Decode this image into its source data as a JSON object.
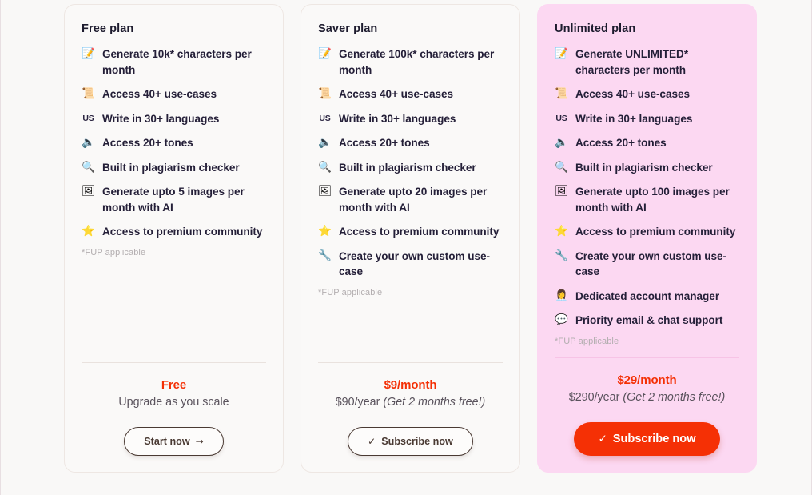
{
  "page": {
    "background_color": "#f9f8f7",
    "accent_color": "#f43005",
    "featured_card_color": "#fcd8f2"
  },
  "plans": [
    {
      "id": "free",
      "title": "Free plan",
      "featured": false,
      "features": [
        {
          "icon": "memo-icon",
          "glyph": "📝",
          "text": "Generate 10k* characters per month"
        },
        {
          "icon": "scroll-icon",
          "glyph": "📜",
          "text": "Access 40+ use-cases"
        },
        {
          "icon": "us-flag-icon",
          "glyph": "US",
          "text": "Write in 30+ languages"
        },
        {
          "icon": "speaker-icon",
          "glyph": "🔈",
          "text": "Access 20+ tones"
        },
        {
          "icon": "magnifier-icon",
          "glyph": "🔍",
          "text": "Built in plagiarism checker"
        },
        {
          "icon": "framed-picture-icon",
          "glyph": "🖼",
          "text": "Generate upto 5 images per month with AI"
        },
        {
          "icon": "star-icon",
          "glyph": "⭐",
          "text": "Access to premium community"
        }
      ],
      "footnote": "*FUP applicable",
      "price_main": "Free",
      "price_sub": "",
      "price_note": "",
      "tagline": "Upgrade as you scale",
      "cta": {
        "label": "Start now",
        "glyph": "→",
        "glyph_position": "after",
        "style": "outline"
      }
    },
    {
      "id": "saver",
      "title": "Saver plan",
      "featured": false,
      "features": [
        {
          "icon": "memo-icon",
          "glyph": "📝",
          "text": "Generate 100k* characters per month"
        },
        {
          "icon": "scroll-icon",
          "glyph": "📜",
          "text": "Access 40+ use-cases"
        },
        {
          "icon": "us-flag-icon",
          "glyph": "US",
          "text": "Write in 30+ languages"
        },
        {
          "icon": "speaker-icon",
          "glyph": "🔈",
          "text": "Access 20+ tones"
        },
        {
          "icon": "magnifier-icon",
          "glyph": "🔍",
          "text": "Built in plagiarism checker"
        },
        {
          "icon": "framed-picture-icon",
          "glyph": "🖼",
          "text": "Generate upto 20 images per month with AI"
        },
        {
          "icon": "star-icon",
          "glyph": "⭐",
          "text": "Access to premium community"
        },
        {
          "icon": "wrench-icon",
          "glyph": "🔧",
          "text": "Create your own custom use-case"
        }
      ],
      "footnote": "*FUP applicable",
      "price_main": "$9/month",
      "price_sub": "$90/year ",
      "price_note": "(Get 2 months free!)",
      "tagline": "",
      "cta": {
        "label": "Subscribe now",
        "glyph": "✓",
        "glyph_position": "before",
        "style": "outline"
      }
    },
    {
      "id": "unlimited",
      "title": "Unlimited plan",
      "featured": true,
      "features": [
        {
          "icon": "memo-icon",
          "glyph": "📝",
          "text": "Generate UNLIMITED* characters per month"
        },
        {
          "icon": "scroll-icon",
          "glyph": "📜",
          "text": "Access 40+ use-cases"
        },
        {
          "icon": "us-flag-icon",
          "glyph": "US",
          "text": "Write in 30+ languages"
        },
        {
          "icon": "speaker-icon",
          "glyph": "🔈",
          "text": "Access 20+ tones"
        },
        {
          "icon": "magnifier-icon",
          "glyph": "🔍",
          "text": "Built in plagiarism checker"
        },
        {
          "icon": "framed-picture-icon",
          "glyph": "🖼",
          "text": "Generate upto 100 images per month with AI"
        },
        {
          "icon": "star-icon",
          "glyph": "⭐",
          "text": "Access to premium community"
        },
        {
          "icon": "wrench-icon",
          "glyph": "🔧",
          "text": "Create your own custom use-case"
        },
        {
          "icon": "office-worker-icon",
          "glyph": "👩‍💼",
          "text": "Dedicated account manager"
        },
        {
          "icon": "speech-balloon-icon",
          "glyph": "💬",
          "text": "Priority email & chat support"
        }
      ],
      "footnote": "*FUP applicable",
      "price_main": "$29/month",
      "price_sub": "$290/year ",
      "price_note": "(Get 2 months free!)",
      "tagline": "",
      "cta": {
        "label": "Subscribe now",
        "glyph": "✓",
        "glyph_position": "before",
        "style": "solid"
      }
    }
  ]
}
